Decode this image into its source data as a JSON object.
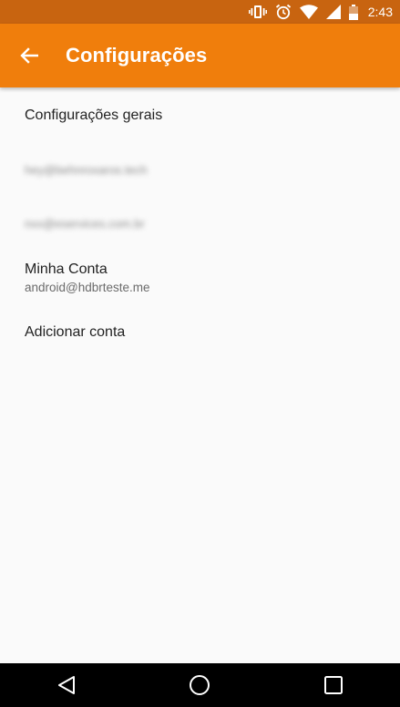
{
  "status_bar": {
    "time": "2:43",
    "icons": [
      "vibrate-icon",
      "alarm-icon",
      "wifi-icon",
      "signal-icon",
      "battery-icon"
    ]
  },
  "app_bar": {
    "title": "Configurações",
    "background": "#f07e0c",
    "status_background": "#c86410"
  },
  "list": {
    "general_settings": "Configurações gerais",
    "account_1": "hey@behnroxaros.tech",
    "account_2": "nxx@eservices.com.br",
    "my_account_title": "Minha Conta",
    "my_account_email": "android@hdbrteste.me",
    "add_account": "Adicionar conta"
  },
  "nav_bar": {
    "icons": [
      "back-triangle-icon",
      "home-circle-icon",
      "recents-square-icon"
    ]
  }
}
